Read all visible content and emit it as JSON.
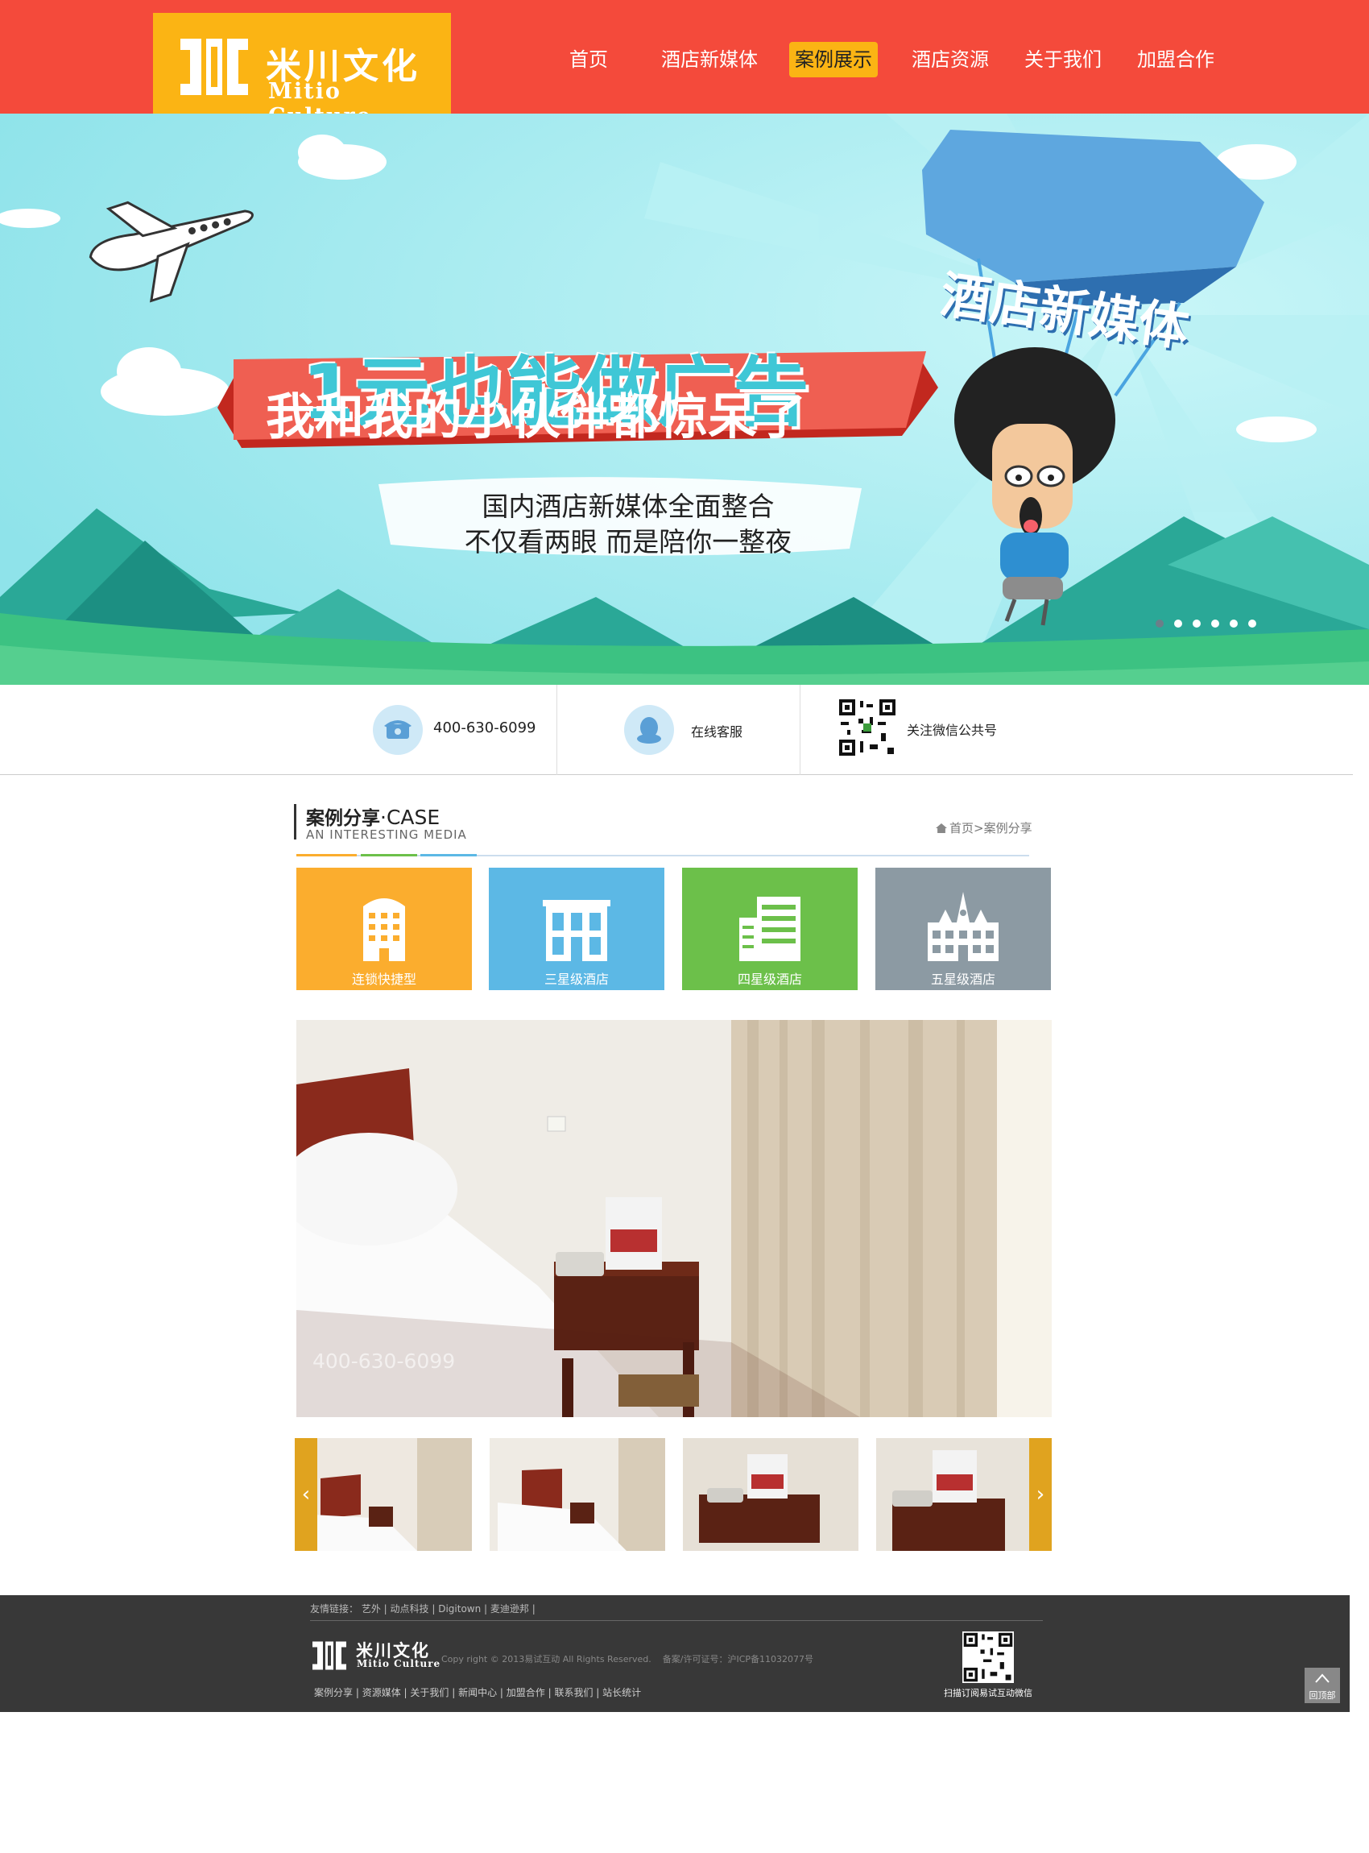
{
  "header": {
    "logo_cn": "米川文化",
    "logo_en": "Mitio Culture",
    "nav": [
      {
        "label": "首页"
      },
      {
        "label": "酒店新媒体"
      },
      {
        "label": "案例展示"
      },
      {
        "label": "酒店资源"
      },
      {
        "label": "关于我们"
      },
      {
        "label": "加盟合作"
      }
    ],
    "active_index": 2
  },
  "banner": {
    "badge": "酒店新媒体",
    "headline": "1元也能做广告",
    "ribbon": "我和我的小伙伴都惊呆了",
    "line1": "国内酒店新媒体全面整合",
    "line2": "不仅看两眼 而是陪你一整夜",
    "slide_count": 6,
    "active_slide": 0
  },
  "contact": {
    "phone": "400-630-6099",
    "service": "在线客服",
    "wechat": "关注微信公共号"
  },
  "section": {
    "title": "案例分享",
    "title_en": "·CASE",
    "subtitle": "AN INTERESTING MEDIA",
    "breadcrumb_home": "首页",
    "breadcrumb_sep": ">",
    "breadcrumb_current": "案例分享"
  },
  "categories": [
    {
      "label": "连锁快捷型",
      "color": "#fbad2e"
    },
    {
      "label": "三星级酒店",
      "color": "#5cb8e5"
    },
    {
      "label": "四星级酒店",
      "color": "#6cc04a"
    },
    {
      "label": "五星级酒店",
      "color": "#8c9aa3"
    }
  ],
  "photo": {
    "overlay_phone": "400-630-6099"
  },
  "carousel": {
    "prev": "‹",
    "next": "›"
  },
  "footer": {
    "links_label": "友情链接：",
    "links": [
      "艺外",
      "动点科技",
      "Digitown",
      "麦迪逊邦"
    ],
    "logo_cn": "米川文化",
    "logo_en": "Mitio Culture",
    "copyright": "Copy right © 2013易试互动 All Rights Reserved.",
    "icp": "备案/许可证号：沪ICP备11032077号",
    "nav": [
      "案例分享",
      "资源媒体",
      "关于我们",
      "新闻中心",
      "加盟合作",
      "联系我们",
      "站长统计"
    ],
    "qr_caption": "扫描订阅易试互动微信",
    "back_to_top": "回顶部"
  },
  "colors": {
    "header_red": "#f44a3b",
    "accent_yellow": "#fbb414",
    "sky": "#a5ecf1",
    "footer_dark": "#383838"
  }
}
